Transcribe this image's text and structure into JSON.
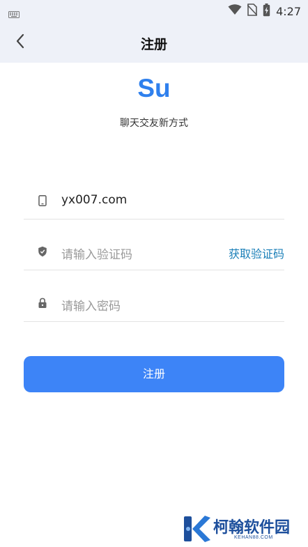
{
  "status_bar": {
    "time": "4:27"
  },
  "app_bar": {
    "title": "注册"
  },
  "brand": {
    "logo_text": "Su",
    "slogan": "聊天交友新方式"
  },
  "form": {
    "phone": {
      "value": "yx007.com"
    },
    "code": {
      "placeholder": "请输入验证码",
      "get_code_label": "获取验证码"
    },
    "password": {
      "placeholder": "请输入密码"
    },
    "submit_label": "注册"
  },
  "watermark": {
    "text": "柯翰软件园",
    "sub": "KEHAN88.COM"
  },
  "colors": {
    "accent": "#3d84f7",
    "link": "#1a7fb8",
    "logo": "#2f80ed",
    "bar_bg": "#eef1f8"
  }
}
